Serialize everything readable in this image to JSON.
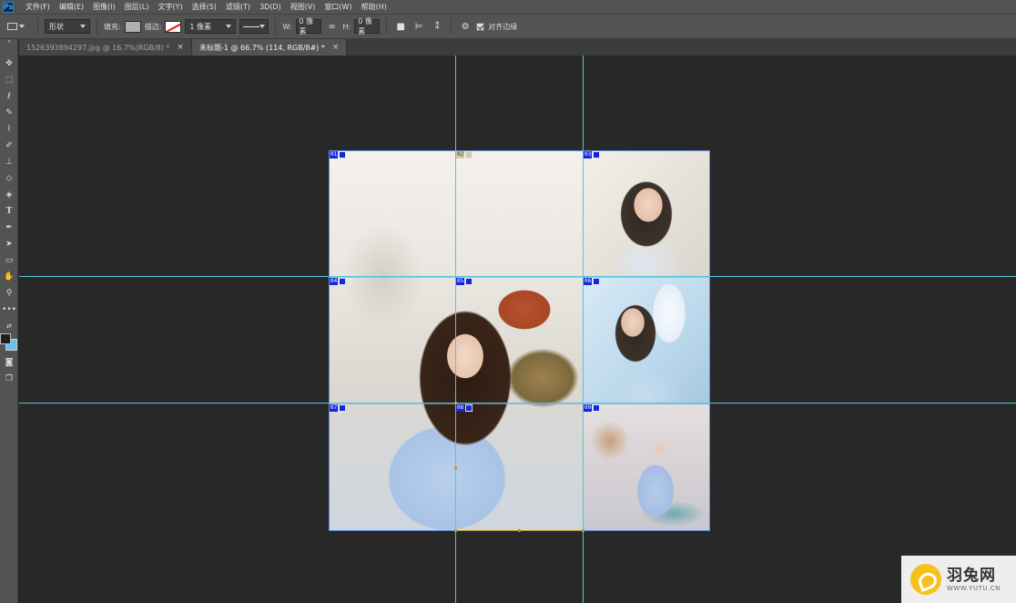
{
  "app": {
    "logo_text": "Ps"
  },
  "menu": [
    "文件(F)",
    "编辑(E)",
    "图像(I)",
    "图层(L)",
    "文字(Y)",
    "选择(S)",
    "滤镜(T)",
    "3D(D)",
    "视图(V)",
    "窗口(W)",
    "帮助(H)"
  ],
  "options": {
    "mode_value": "形状",
    "fill_label": "填充:",
    "stroke_label": "描边:",
    "stroke_width_value": "1 像素",
    "w_label": "W:",
    "w_value": "0 像素",
    "link_icon": "link-icon",
    "h_label": "H:",
    "h_value": "0 像素",
    "align_edges_label": "对齐边缘",
    "fill_color": "#b0b0b0",
    "stroke_color": "#e0211c"
  },
  "tabs": [
    {
      "label": "1526393894297.jpg @ 16.7%(RGB/8) *",
      "active": false
    },
    {
      "label": "未标题-1 @ 66.7% (114, RGB/8#) *",
      "active": true
    }
  ],
  "slices": [
    {
      "num": "01"
    },
    {
      "num": "02"
    },
    {
      "num": "03"
    },
    {
      "num": "04"
    },
    {
      "num": "05"
    },
    {
      "num": "06"
    },
    {
      "num": "07"
    },
    {
      "num": "08"
    },
    {
      "num": "09"
    }
  ],
  "colors": {
    "foreground": "#1f1f1f",
    "background": "#69bdf0",
    "guide": "#4fc7d8",
    "slice_label": "#1428d8"
  },
  "watermark": {
    "cn": "羽兔网",
    "en": "WWW.YUTU.CN"
  }
}
